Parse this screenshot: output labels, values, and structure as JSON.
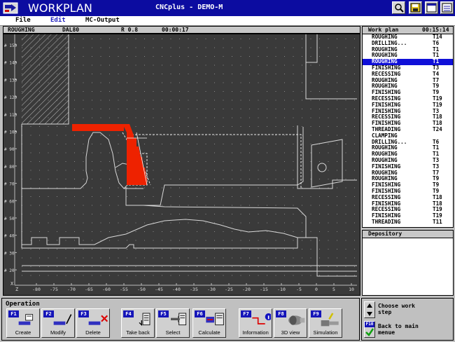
{
  "titlebar": {
    "app_title": "WORKPLAN",
    "window_title": "CNCplus - DEMO-M",
    "icons": [
      "magnifier-icon",
      "disk-icon",
      "window-icon",
      "list-icon"
    ],
    "color": "#0c0ca0"
  },
  "menu": {
    "file": "File",
    "edit": "Edit",
    "mc_output": "MC-Output"
  },
  "status": {
    "operation": "ROUGHING",
    "tool": "DAL80",
    "radius": "R 0.8",
    "time": "00:00:17"
  },
  "workplan": {
    "title": "Work plan",
    "time": "00:15:14",
    "selected_index": 4,
    "items": [
      {
        "op": "ROUGHING",
        "tool": "T14"
      },
      {
        "op": "DRILLING...",
        "tool": "T6"
      },
      {
        "op": "ROUGHING",
        "tool": "T1"
      },
      {
        "op": "ROUGHING",
        "tool": "T1"
      },
      {
        "op": "ROUGHING",
        "tool": "T1"
      },
      {
        "op": "FINISHING",
        "tool": "T3"
      },
      {
        "op": "RECESSING",
        "tool": "T4"
      },
      {
        "op": "ROUGHING",
        "tool": "T7"
      },
      {
        "op": "ROUGHING",
        "tool": "T9"
      },
      {
        "op": "FINISHING",
        "tool": "T9"
      },
      {
        "op": "RECESSING",
        "tool": "T19"
      },
      {
        "op": "FINISHING",
        "tool": "T19"
      },
      {
        "op": "FINISHING",
        "tool": "T3"
      },
      {
        "op": "RECESSING",
        "tool": "T18"
      },
      {
        "op": "FINISHING",
        "tool": "T18"
      },
      {
        "op": "THREADING",
        "tool": "T24"
      },
      {
        "op": "CLAMPING",
        "tool": ""
      },
      {
        "op": "DRILLING...",
        "tool": "T6"
      },
      {
        "op": "ROUGHING",
        "tool": "T1"
      },
      {
        "op": "ROUGHING",
        "tool": "T1"
      },
      {
        "op": "ROUGHING",
        "tool": "T3"
      },
      {
        "op": "FINISHING",
        "tool": "T3"
      },
      {
        "op": "ROUGHING",
        "tool": "T7"
      },
      {
        "op": "ROUGHING",
        "tool": "T9"
      },
      {
        "op": "FINISHING",
        "tool": "T9"
      },
      {
        "op": "FINISHING",
        "tool": "T9"
      },
      {
        "op": "RECESSING",
        "tool": "T18"
      },
      {
        "op": "FINISHING",
        "tool": "T18"
      },
      {
        "op": "RECESSING",
        "tool": "T19"
      },
      {
        "op": "FINISHING",
        "tool": "T19"
      },
      {
        "op": "THREADING",
        "tool": "T11"
      }
    ]
  },
  "depository": {
    "title": "Depository"
  },
  "graphic": {
    "x_axis_label": "Z",
    "y_axis_label": "X",
    "x_ticks": [
      "-80",
      "-75",
      "-70",
      "-65",
      "-60",
      "-55",
      "-50",
      "-45",
      "-40",
      "-35",
      "-30",
      "-25",
      "-20",
      "-15",
      "-10",
      "-5",
      "0",
      "5",
      "10"
    ],
    "y_ticks": [
      "# 150",
      "# 140",
      "# 130",
      "# 120",
      "# 110",
      "# 100",
      "# 90",
      "# 80",
      "# 70",
      "# 60",
      "# 50",
      "# 40",
      "# 30",
      "# 20"
    ],
    "highlight_color": "#ee2200"
  },
  "operation_panel": {
    "title": "Operation",
    "buttons": [
      {
        "key": "F1",
        "label": "Create",
        "icon": "create-icon"
      },
      {
        "key": "F2",
        "label": "Modify",
        "icon": "modify-icon"
      },
      {
        "key": "F3",
        "label": "Delete",
        "icon": "delete-icon"
      },
      {
        "key": "F4",
        "label": "Take back",
        "icon": "take-back-icon"
      },
      {
        "key": "F5",
        "label": "Select",
        "icon": "select-icon"
      },
      {
        "key": "F6",
        "label": "Calculate",
        "icon": "calculate-icon"
      },
      {
        "key": "F7",
        "label": "Information",
        "icon": "information-icon"
      },
      {
        "key": "F8",
        "label": "3D view",
        "icon": "3d-view-icon"
      },
      {
        "key": "F9",
        "label": "Simulation",
        "icon": "simulation-icon"
      }
    ]
  },
  "nav_panel": {
    "choose_step": "Choose work step",
    "f10_key": "F10",
    "back_to_main": "Back to main menue"
  }
}
